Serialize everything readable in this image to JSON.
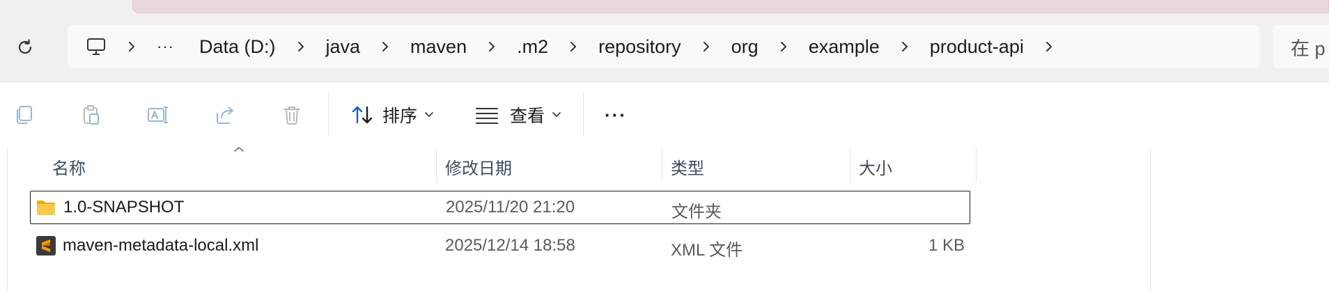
{
  "breadcrumb": {
    "overflow": "···",
    "items": [
      "Data (D:)",
      "java",
      "maven",
      ".m2",
      "repository",
      "org",
      "example",
      "product-api"
    ]
  },
  "search": {
    "placeholder": "在 p"
  },
  "toolbar": {
    "sort_label": "排序",
    "view_label": "查看",
    "more_label": "···"
  },
  "columns": {
    "name": "名称",
    "date": "修改日期",
    "type": "类型",
    "size": "大小"
  },
  "files": [
    {
      "name": "1.0-SNAPSHOT",
      "date": "2025/11/20 21:20",
      "type": "文件夹",
      "size": "",
      "icon": "folder-icon"
    },
    {
      "name": "maven-metadata-local.xml",
      "date": "2025/12/14 18:58",
      "type": "XML 文件",
      "size": "1 KB",
      "icon": "sublime-file-icon"
    }
  ],
  "colors": {
    "chrome_bg": "#f3eef2",
    "tab_active": "#ead6df",
    "folder": "#f5c542",
    "sublime_bg": "#3a3a3a",
    "sublime_accent": "#ff9800"
  }
}
